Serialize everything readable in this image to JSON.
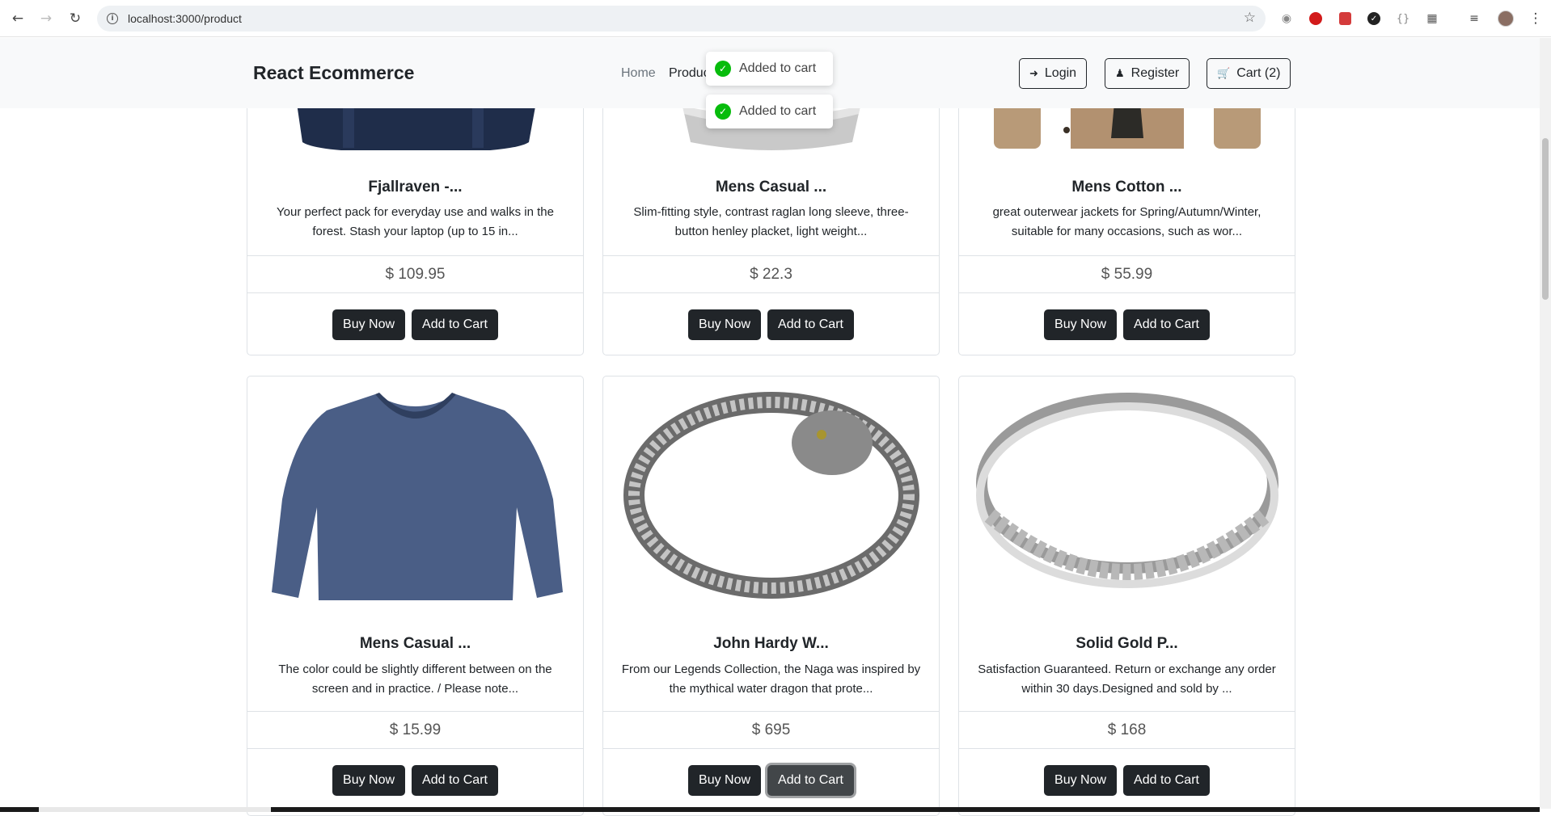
{
  "browser": {
    "url": "localhost:3000/product"
  },
  "navbar": {
    "brand": "React Ecommerce",
    "links": [
      {
        "label": "Home"
      },
      {
        "label": "Produc"
      }
    ],
    "login_label": "Login",
    "register_label": "Register",
    "cart_label": "Cart (2)"
  },
  "toasts": [
    {
      "message": "Added to cart"
    },
    {
      "message": "Added to cart"
    }
  ],
  "products": [
    {
      "title": "Fjallraven -...",
      "description": "Your perfect pack for everyday use and walks in the forest. Stash your laptop (up to 15 in...",
      "price": "$ 109.95",
      "buy_label": "Buy Now",
      "cart_label": "Add to Cart"
    },
    {
      "title": "Mens Casual ...",
      "description": "Slim-fitting style, contrast raglan long sleeve, three-button henley placket, light weight...",
      "price": "$ 22.3",
      "buy_label": "Buy Now",
      "cart_label": "Add to Cart"
    },
    {
      "title": "Mens Cotton ...",
      "description": "great outerwear jackets for Spring/Autumn/Winter, suitable for many occasions, such as wor...",
      "price": "$ 55.99",
      "buy_label": "Buy Now",
      "cart_label": "Add to Cart"
    },
    {
      "title": "Mens Casual ...",
      "description": "The color could be slightly different between on the screen and in practice. / Please note...",
      "price": "$ 15.99",
      "buy_label": "Buy Now",
      "cart_label": "Add to Cart"
    },
    {
      "title": "John Hardy W...",
      "description": "From our Legends Collection, the Naga was inspired by the mythical water dragon that prote...",
      "price": "$ 695",
      "buy_label": "Buy Now",
      "cart_label": "Add to Cart"
    },
    {
      "title": "Solid Gold P...",
      "description": "Satisfaction Guaranteed. Return or exchange any order within 30 days.Designed and sold by ...",
      "price": "$ 168",
      "buy_label": "Buy Now",
      "cart_label": "Add to Cart"
    }
  ],
  "colors": {
    "dark": "#212529",
    "toast_success": "#07bc0c",
    "navbar_bg": "#f8f9fa"
  }
}
